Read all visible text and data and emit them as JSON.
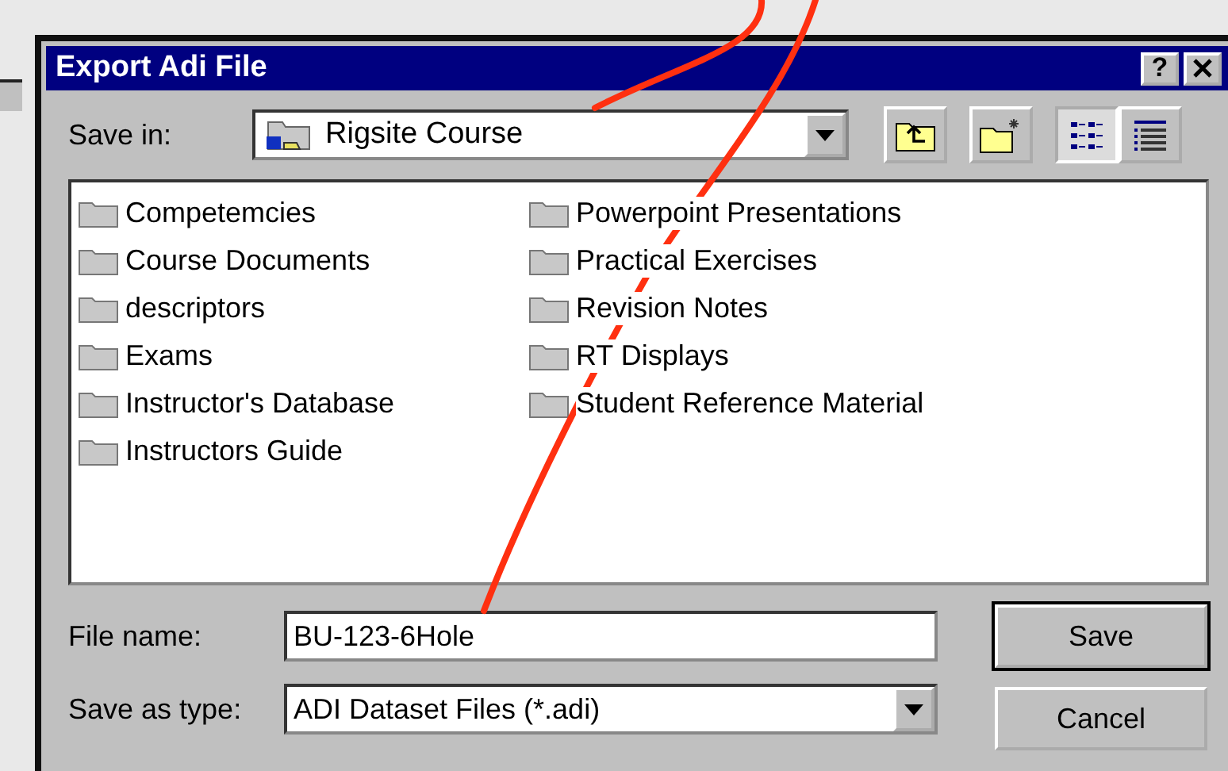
{
  "window": {
    "title": "Export Adi File",
    "help": "?"
  },
  "save_in": {
    "label": "Save in:",
    "value": "Rigsite Course"
  },
  "views": [
    {
      "kind": "list",
      "selected": true
    },
    {
      "kind": "details",
      "selected": false
    }
  ],
  "files": [
    "Competemcies",
    "Course Documents",
    "descriptors",
    "Exams",
    "Instructor's Database",
    "Instructors Guide",
    "Powerpoint Presentations",
    "Practical Exercises",
    "Revision Notes",
    "RT Displays",
    "Student Reference Material"
  ],
  "file_name": {
    "label": "File name:",
    "value": "BU-123-6Hole"
  },
  "save_as_type": {
    "label": "Save as type:",
    "value": "ADI Dataset Files (*.adi)"
  },
  "buttons": [
    {
      "label": "Save",
      "default": true
    },
    {
      "label": "Cancel",
      "default": false
    }
  ]
}
